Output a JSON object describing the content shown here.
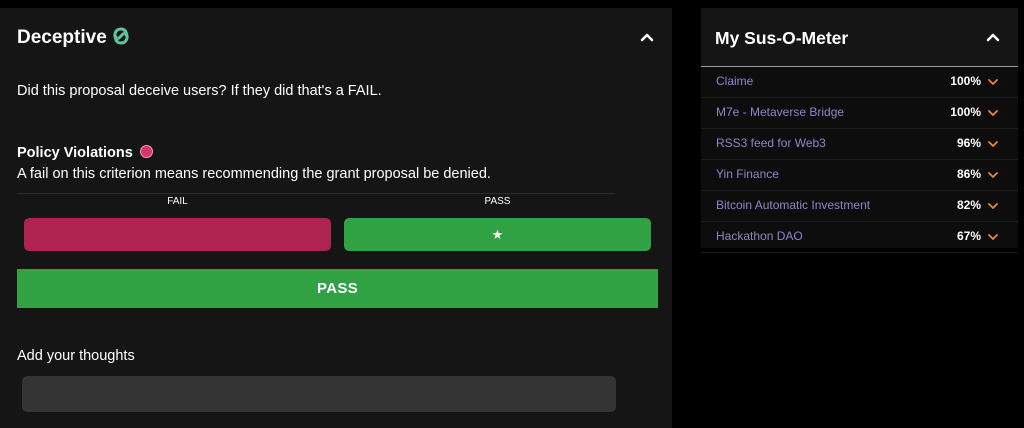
{
  "deceptive": {
    "title": "Deceptive",
    "question": "Did this proposal deceive users? If they did that's a FAIL.",
    "policy_title": "Policy Violations",
    "policy_description": "A fail on this criterion means recommending the grant proposal be denied.",
    "fail_label": "FAIL",
    "pass_label": "PASS",
    "selected_mark": "★",
    "result": "PASS",
    "thoughts_label": "Add your thoughts",
    "thoughts_value": "",
    "colors": {
      "fail": "#ae2350",
      "pass": "#31a244",
      "logo": "#5fc49a",
      "policy_dot": "#d8336a"
    }
  },
  "sus_meter": {
    "title": "My Sus-O-Meter",
    "items": [
      {
        "name": "Claime",
        "percent": "100%"
      },
      {
        "name": "M7e - Metaverse Bridge",
        "percent": "100%"
      },
      {
        "name": "RSS3 feed for Web3",
        "percent": "96%"
      },
      {
        "name": "Yin Finance",
        "percent": "86%"
      },
      {
        "name": "Bitcoin Automatic Investment",
        "percent": "82%"
      },
      {
        "name": "Hackathon DAO",
        "percent": "67%"
      }
    ],
    "colors": {
      "item_name": "#8f86c9",
      "chevron": "#f0852a"
    }
  },
  "icons": {
    "logo": "link-loop-icon",
    "collapse": "chevron-up-icon",
    "expand": "chevron-down-icon"
  }
}
